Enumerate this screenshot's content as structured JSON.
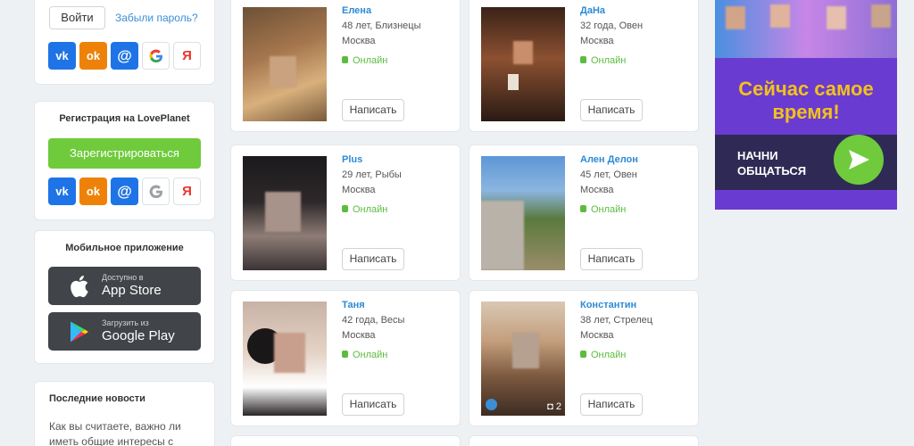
{
  "login": {
    "login_label": "Войти",
    "forgot_label": "Забыли пароль?"
  },
  "registration": {
    "title": "Регистрация на LovePlanet",
    "register_label": "Зарегистрироваться"
  },
  "social": {
    "vk": "vk",
    "ok": "ok",
    "mail": "@",
    "google": "G",
    "yandex": "Я"
  },
  "mobile": {
    "title": "Мобильное приложение",
    "appstore_small": "Доступно в",
    "appstore_big": "App Store",
    "gplay_small": "Загрузить из",
    "gplay_big": "Google Play"
  },
  "news": {
    "title": "Последние новости",
    "text": "Как вы считаете, важно ли иметь общие интересы с"
  },
  "profiles": [
    {
      "name": "Елена",
      "info": "48 лет, Близнецы",
      "city": "Москва",
      "status": "Онлайн",
      "write": "Написать"
    },
    {
      "name": "ДаНа",
      "info": "32 года, Овен",
      "city": "Москва",
      "status": "Онлайн",
      "write": "Написать"
    },
    {
      "name": "Plus",
      "info": "29 лет, Рыбы",
      "city": "Москва",
      "status": "Онлайн",
      "write": "Написать"
    },
    {
      "name": "Ален Делон",
      "info": "45 лет, Овен",
      "city": "Москва",
      "status": "Онлайн",
      "write": "Написать"
    },
    {
      "name": "Таня",
      "info": "42 года, Весы",
      "city": "Москва",
      "status": "Онлайн",
      "write": "Написать"
    },
    {
      "name": "Константин",
      "info": "38 лет, Стрелец",
      "city": "Москва",
      "status": "Онлайн",
      "write": "Написать",
      "photo_count": "2"
    }
  ],
  "ad": {
    "slogan": "Сейчас самое время!",
    "cta": "НАЧНИ ОБЩАТЬСЯ"
  },
  "colors": {
    "accent_blue": "#2d8ad6",
    "online_green": "#5cbc3e",
    "register_green": "#6fcb3c"
  }
}
